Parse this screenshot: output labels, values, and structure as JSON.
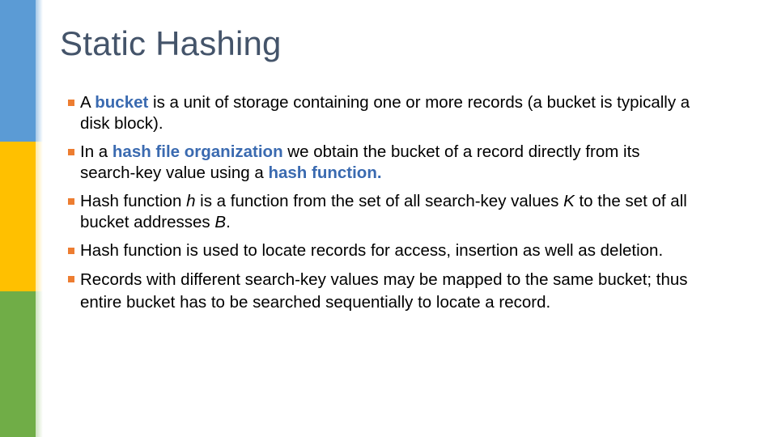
{
  "slide": {
    "title": "Static Hashing",
    "accent_colors": {
      "stripe_top": "#5b9bd5",
      "stripe_middle": "#ffc000",
      "stripe_bottom": "#70ad47",
      "bullet": "#ed7d31",
      "highlight": "#3a6ab0",
      "title": "#44546a"
    },
    "bullets": [
      {
        "parts": [
          "A ",
          "bucket",
          " is a unit of storage containing one or more records (a bucket is typically a disk block)."
        ]
      },
      {
        "parts": [
          "In a ",
          "hash file organization",
          " we obtain the bucket of a record directly from its search-key value using a ",
          "hash function."
        ]
      },
      {
        "parts": [
          "Hash function ",
          "h",
          " is a function from the set of all search-key values ",
          "K",
          " to the set of all bucket addresses ",
          "B",
          "."
        ]
      },
      {
        "parts": [
          "Hash function is used to locate records for access, insertion as well as deletion."
        ]
      },
      {
        "parts": [
          "Records with different search-key values may be mapped to the same bucket; thus entire bucket has to be searched sequentially to locate a record."
        ]
      }
    ]
  }
}
